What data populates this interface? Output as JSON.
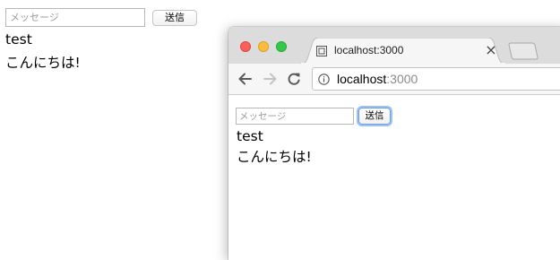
{
  "background_page": {
    "message_input": {
      "placeholder": "メッセージ",
      "value": ""
    },
    "send_button": "送信",
    "messages": [
      "test",
      "こんにちは!"
    ]
  },
  "browser": {
    "tab": {
      "title": "localhost:3000"
    },
    "address_bar": {
      "host": "localhost",
      "port": ":3000"
    },
    "page": {
      "message_input": {
        "placeholder": "メッセージ",
        "value": ""
      },
      "send_button": "送信",
      "messages": [
        "test",
        "こんにちは!"
      ]
    }
  },
  "colors": {
    "close": "#fc605c",
    "minimize": "#fdbc40",
    "zoom": "#34c84a",
    "focus_ring": "#9ec3f3"
  },
  "icons": [
    "back-arrow-icon",
    "forward-arrow-icon",
    "reload-icon",
    "info-icon",
    "page-favicon-icon",
    "close-icon",
    "new-tab-icon"
  ]
}
